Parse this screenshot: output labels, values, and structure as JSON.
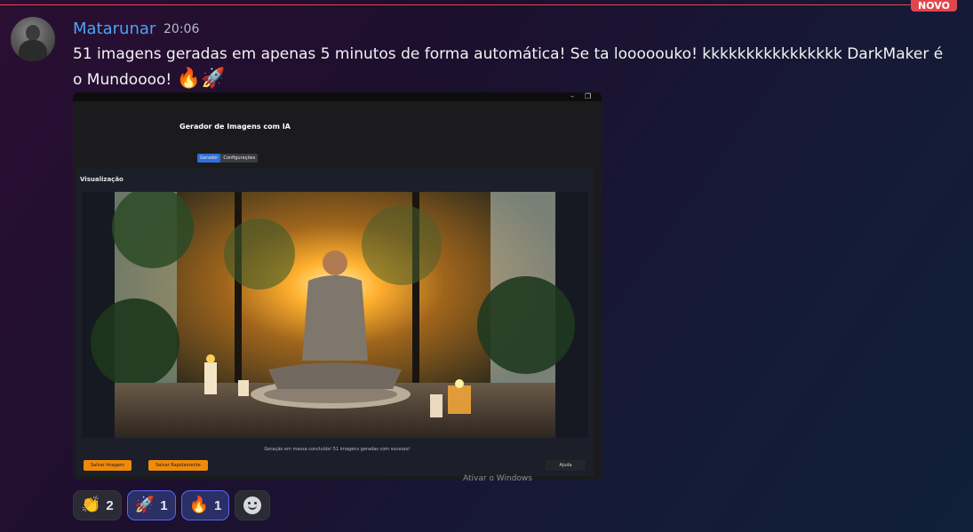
{
  "badge": "NOVO",
  "message": {
    "author": "Matarunar",
    "time": "20:06",
    "text": "51 imagens geradas em apenas 5 minutos de forma automática! Se ta looooouko! kkkkkkkkkkkkkkkk DarkMaker é o Mundoooo!",
    "trailing_emojis": "🔥🚀"
  },
  "attachment": {
    "app_title": "Gerador de Imagens com IA",
    "tabs": [
      "Gerador",
      "Configurações"
    ],
    "active_tab": "Gerador",
    "section_title": "Visualização",
    "status": "Geração em massa concluída! 51 imagens geradas com sucesso!",
    "buttons": {
      "save": "Salvar Imagem",
      "quick_save": "Salvar Rapidamente",
      "help": "Ajuda"
    },
    "window_controls": {
      "minimize": "–",
      "restore": "❐"
    },
    "image_subject": "meditation-scene"
  },
  "watermark": "Ativar o Windows",
  "reactions": [
    {
      "emoji": "👏",
      "count": "2",
      "me": false
    },
    {
      "emoji": "🚀",
      "count": "1",
      "me": true
    },
    {
      "emoji": "🔥",
      "count": "1",
      "me": true
    }
  ],
  "add_reaction_icon": "smiley-icon",
  "colors": {
    "accent_red": "#e2464d",
    "author": "#4fa3f0",
    "orange_button": "#f08a0c",
    "active_tab": "#2f6fdc"
  }
}
